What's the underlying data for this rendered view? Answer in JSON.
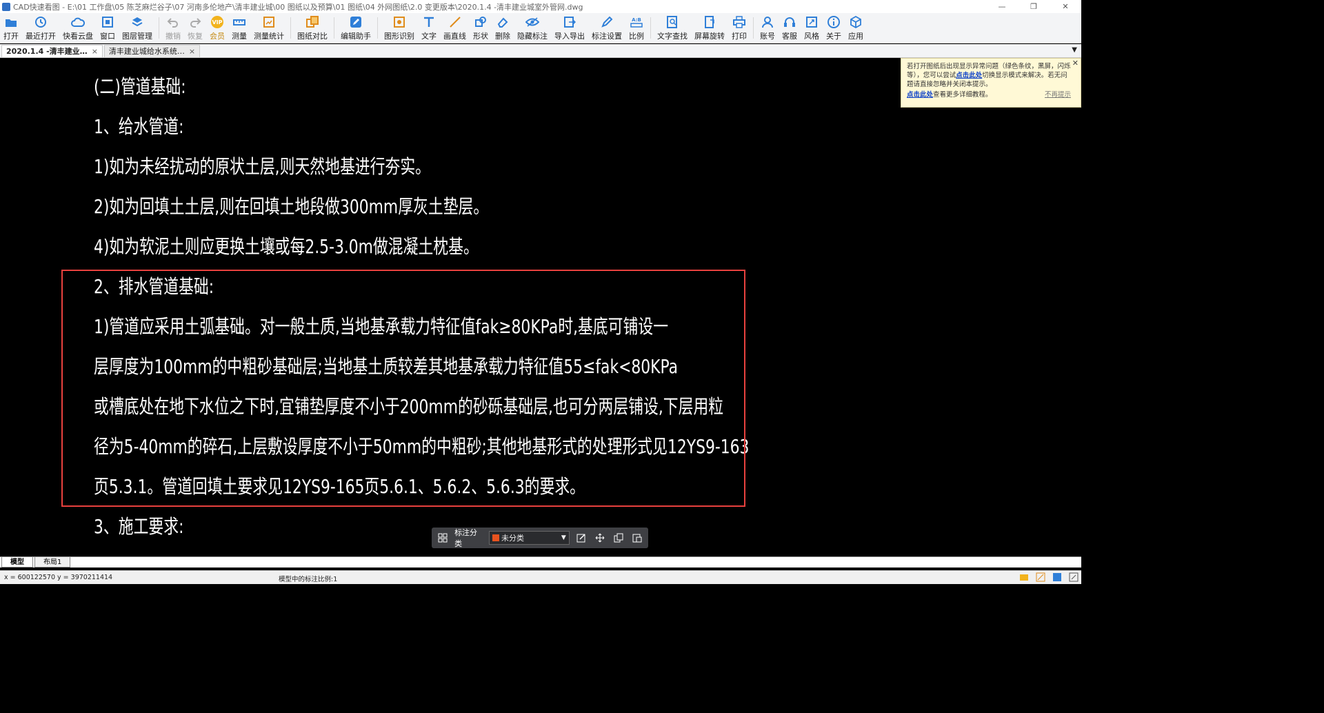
{
  "window": {
    "title": "CAD快速看图 - E:\\01 工作盘\\05 陈芝麻烂谷子\\07 河南多伦地产\\清丰建业城\\00 图纸以及预算\\01 图纸\\04 外网图纸\\2.0 变更版本\\2020.1.4 -清丰建业城室外管网.dwg",
    "controls": [
      "—",
      "❐",
      "✕"
    ]
  },
  "toolbar": [
    {
      "label": "打开",
      "icon": "open-folder-icon"
    },
    {
      "label": "最近打开",
      "icon": "recent-icon"
    },
    {
      "label": "快看云盘",
      "icon": "cloud-icon"
    },
    {
      "label": "窗口",
      "icon": "window-icon"
    },
    {
      "label": "图层管理",
      "icon": "layers-icon"
    },
    {
      "label": "撤销",
      "icon": "undo-icon"
    },
    {
      "label": "恢复",
      "icon": "redo-icon"
    },
    {
      "label": "会员",
      "icon": "vip-icon"
    },
    {
      "label": "测量",
      "icon": "measure-icon"
    },
    {
      "label": "测量统计",
      "icon": "measure-stats-icon"
    },
    {
      "label": "图纸对比",
      "icon": "compare-icon"
    },
    {
      "label": "编辑助手",
      "icon": "edit-assistant-icon"
    },
    {
      "label": "图形识别",
      "icon": "shape-recognize-icon"
    },
    {
      "label": "文字",
      "icon": "text-icon"
    },
    {
      "label": "画直线",
      "icon": "line-icon"
    },
    {
      "label": "形状",
      "icon": "shape-icon"
    },
    {
      "label": "删除",
      "icon": "eraser-icon"
    },
    {
      "label": "隐藏标注",
      "icon": "eye-hide-icon"
    },
    {
      "label": "导入导出",
      "icon": "import-export-icon"
    },
    {
      "label": "标注设置",
      "icon": "annotation-settings-icon"
    },
    {
      "label": "比例",
      "icon": "scale-icon"
    },
    {
      "label": "文字查找",
      "icon": "text-search-icon"
    },
    {
      "label": "屏幕旋转",
      "icon": "rotate-screen-icon"
    },
    {
      "label": "打印",
      "icon": "print-icon"
    },
    {
      "label": "账号",
      "icon": "account-icon"
    },
    {
      "label": "客服",
      "icon": "headset-icon"
    },
    {
      "label": "风格",
      "icon": "style-icon"
    },
    {
      "label": "关于",
      "icon": "info-icon"
    },
    {
      "label": "应用",
      "icon": "apps-cube-icon"
    }
  ],
  "tabs": [
    {
      "label": "2020.1.4 -清丰建业…",
      "active": true
    },
    {
      "label": "清丰建业城给水系统…",
      "active": false
    }
  ],
  "drawing_text": [
    "(二)管道基础:",
    "1、给水管道:",
    "1)如为未经扰动的原状土层,则天然地基进行夯实。",
    "2)如为回填土土层,则在回填土地段做300mm厚灰土垫层。",
    "4)如为软泥土则应更换土壤或每2.5-3.0m做混凝土枕基。",
    "2、排水管道基础:",
    "1)管道应采用土弧基础。对一般土质,当地基承载力特征值fak≥80KPa时,基底可铺设一",
    "层厚度为100mm的中粗砂基础层;当地基土质较差其地基承载力特征值55≤fak<80KPa",
    "或槽底处在地下水位之下时,宜铺垫厚度不小于200mm的砂砾基础层,也可分两层铺设,下层用粒",
    "径为5-40mm的碎石,上层敷设厚度不小于50mm的中粗砂;其他地基形式的处理形式见12YS9-163",
    "页5.3.1。管道回填土要求见12YS9-165页5.6.1、5.6.2、5.6.3的要求。",
    "3、施工要求:"
  ],
  "notice": {
    "text1": "若打开图纸后出现显示异常问题（绿色条纹，黑屏，闪烁等），您可以尝试",
    "link1": "点击此处",
    "text2": "切换显示模式来解决。若无问题请直接忽略并关闭本提示。",
    "link2": "点击此处",
    "text3": "查看更多详细教程。",
    "dismiss": "不再提示",
    "close": "✕"
  },
  "annotation_bar": {
    "label": "标注分类",
    "selected": "未分类",
    "swatch_color": "#e8531f"
  },
  "layout_tabs": [
    {
      "label": "模型",
      "active": true
    },
    {
      "label": "布局1",
      "active": false
    }
  ],
  "status": {
    "coords": "x = 600122570  y = 3970211414",
    "scale": "模型中的标注比例:1"
  },
  "colors": {
    "highlight": "#e8413e",
    "link": "#0b40c8"
  }
}
